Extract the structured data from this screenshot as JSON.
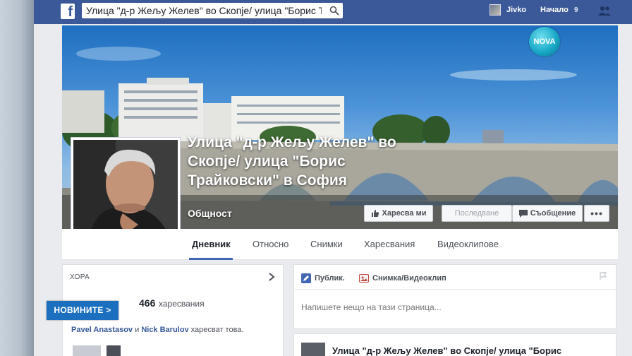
{
  "topbar": {
    "logo": "f",
    "search_value": "Улица \"д-р Жељу Желев\" во Скопје/ улица \"Борис Трай",
    "user_name": "Jivko",
    "home_label": "Начало",
    "home_count": "9"
  },
  "page": {
    "title": "Улица \"д-р Жељу Желев\" во Скопје/ улица \"Борис Трайковски\" в София",
    "category": "Общност",
    "buttons": {
      "like": "Харесва ми",
      "follow": "Последвaне",
      "message": "Съобщение",
      "more": "•••"
    },
    "tabs": [
      "Дневник",
      "Относно",
      "Снимки",
      "Харесвания",
      "Видеоклипове"
    ]
  },
  "people": {
    "heading": "ХОРА",
    "like_count": "466",
    "likes_word": "харесвания",
    "friend1": "Pavel Anastasov",
    "and_word": "и",
    "friend2": "Nick Barulov",
    "suffix": "харесват това."
  },
  "composer": {
    "status_tab": "Публик.",
    "photo_tab": "Снимка/Видеоклип",
    "placeholder": "Напишете нещо на тази страница..."
  },
  "post": {
    "title": "Улица \"д-р Жељу Желев\" во Скопје/ улица \"Борис"
  },
  "overlay": {
    "channel_logo": "NOVA",
    "news_badge": "НОВИНИТЕ >"
  },
  "colors": {
    "facebook_blue": "#3b5998",
    "link_blue": "#365899",
    "news_blue": "#1b6fbe"
  }
}
